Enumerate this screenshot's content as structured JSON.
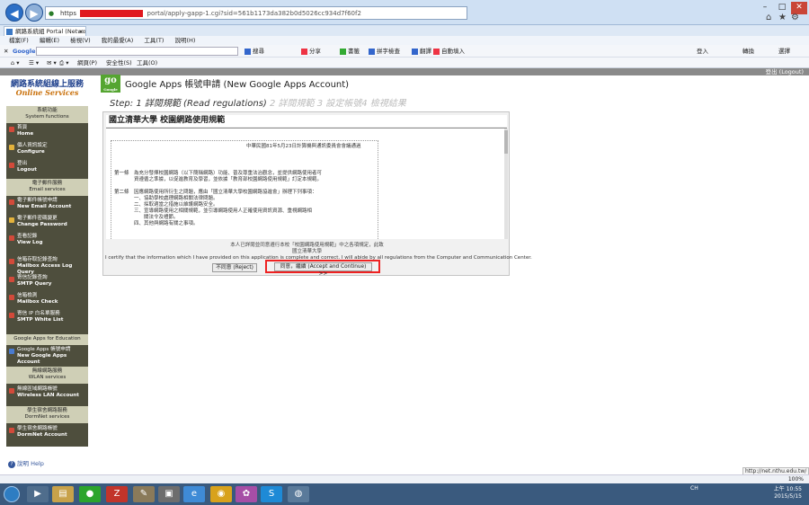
{
  "browser": {
    "address_scheme": "https",
    "address_path": "portal/apply-gapp-1.cgi?sid=561b1173da382b0d5026cc934d7f60f2",
    "tab_title": "網路系統組 Portal (Networ...",
    "tab_close": "×",
    "menu": [
      "檔案(F)",
      "編輯(E)",
      "檢視(V)",
      "我的最愛(A)",
      "工具(T)",
      "說明(H)"
    ],
    "gtoolbar": {
      "close": "✕",
      "logo": "Google",
      "search_label": "搜尋",
      "share": "分享",
      "bookmarks": "書籤",
      "spellcheck": "拼字檢查",
      "translate": "翻譯",
      "autofill": "自動填入",
      "login": "登入",
      "translate2": "轉換",
      "select": "選擇"
    },
    "cmd": [
      "網頁(P)",
      "安全性(S)",
      "工具(O)"
    ],
    "zoom": "100%",
    "status_url": "http://net.nthu.edu.tw/"
  },
  "page": {
    "logout": "登出 (Logout)",
    "brand_title": "網路系統組線上服務",
    "brand_sub": "Online Services",
    "sections": [
      {
        "zh": "系統功能",
        "en": "System functions"
      },
      {
        "zh": "電子郵件服務",
        "en": "Email services"
      },
      {
        "zh": "Google Apps for Education",
        "en": ""
      },
      {
        "zh": "無線網路服務",
        "en": "WLAN services"
      },
      {
        "zh": "學生宿舍網路服務",
        "en": "DormNet services"
      }
    ],
    "nav": [
      {
        "zh": "首頁",
        "en": "Home"
      },
      {
        "zh": "個人資訊設定",
        "en": "Configure"
      },
      {
        "zh": "登出",
        "en": "Logout"
      },
      {
        "zh": "電子郵件帳號申請",
        "en": "New Email Account"
      },
      {
        "zh": "電子郵件密碼變更",
        "en": "Change Password"
      },
      {
        "zh": "查看記錄",
        "en": "View Log"
      },
      {
        "zh": "信箱存取記錄查詢",
        "en": "Mailbox Access Log Query"
      },
      {
        "zh": "寄信記錄查詢",
        "en": "SMTP Query"
      },
      {
        "zh": "信箱檢測",
        "en": "Mailbox Check"
      },
      {
        "zh": "寄信 IP 白名單服務",
        "en": "SMTP White List"
      },
      {
        "zh": "Google Apps 帳號申請",
        "en": "New Google Apps Account"
      },
      {
        "zh": "無線區域網路帳號",
        "en": "Wireless LAN Account"
      },
      {
        "zh": "學生宿舍網路帳號",
        "en": "DormNet Account"
      }
    ],
    "help": "說明 Help",
    "ga_icon": "go",
    "ga_icon_sub": "Google Apps",
    "title": "Google Apps 帳號申請 (New Google Apps Account)",
    "step_prefix": "Step: ",
    "step_current": "1 詳閱規範 (Read regulations)",
    "step_rest": " 2 詳閱規範 3 設定帳號4 檢視結果",
    "panel_title": "國立清華大學 校園網路使用規範",
    "doc_lines": [
      "中華民國81年5月23日計算機與通訊委員會會議通過",
      "第一條　為充分發揮校園網路（以下簡稱網路）功能、普及尊重法治觀念，並提供網路使用者可",
      "　　　　資遵循之準據，以促進教育及學習，並依據「教育部校園網路使用規範」訂定本規範。",
      "第二條　因應網路使用所衍生之問題，應由「國立清華大學校園網路協進會」辦理下列事項：",
      "　　　　一、協助學校處理網路相關法律問題。",
      "　　　　二、採取適當之措施以維護網路安全。",
      "　　　　三、宣導網路使用之相關規範，並引導網路使用人正確使用資訊資源、重視網路相",
      "　　　　　　關法令及禮節。",
      "　　　　四、其他與網路有關之事項。"
    ],
    "notice_zh": "本人已詳閱並同意遵行本校「校園網路使用規範」中之各項規定，此致",
    "notice_org": "國立清華大學",
    "notice_en": "I certify that the information which I have provided on this application is complete and correct. I will abide by all regulations from the Computer and Communication Center.",
    "reject": "不同意 (Reject)",
    "accept": "同意，繼續 (Accept and Continue) >>"
  },
  "taskbar": {
    "tray": "CH",
    "time": "上午 10:55",
    "date": "2015/5/15"
  },
  "colors": {
    "sidebar_bg": "#4e4e3d",
    "section_bg": "#cfcfb6",
    "brand_blue": "#1d3f8c",
    "brand_orange": "#c9700a",
    "highlight": "#e22222"
  }
}
